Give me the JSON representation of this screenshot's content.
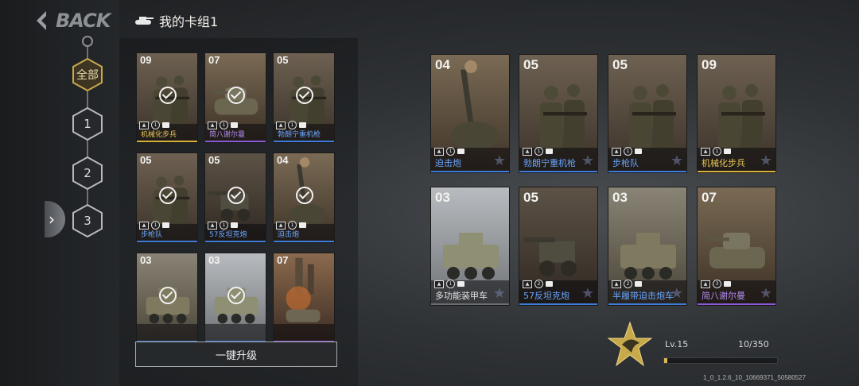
{
  "header": {
    "back_text": "BACK",
    "deck_title": "我的卡组1",
    "deck_icon": "tank-icon"
  },
  "filters": [
    {
      "label": "全部",
      "active": true
    },
    {
      "label": "1",
      "active": false
    },
    {
      "label": "2",
      "active": false
    },
    {
      "label": "3",
      "active": false
    }
  ],
  "collection": [
    {
      "cost": "09",
      "name": "机械化步兵",
      "art": "infantry",
      "rarity": "gold",
      "selected": true
    },
    {
      "cost": "07",
      "name": "简八谢尔曼",
      "art": "tank",
      "rarity": "purple",
      "selected": true
    },
    {
      "cost": "05",
      "name": "勃朗宁重机枪",
      "art": "infantry",
      "rarity": "blue",
      "selected": true
    },
    {
      "cost": "05",
      "name": "步枪队",
      "art": "infantry",
      "rarity": "blue",
      "selected": true
    },
    {
      "cost": "05",
      "name": "57反坦克炮",
      "art": "gun",
      "rarity": "blue",
      "selected": true
    },
    {
      "cost": "04",
      "name": "迫击炮",
      "art": "mortar",
      "rarity": "blue",
      "selected": true
    },
    {
      "cost": "03",
      "name": "",
      "art": "halftrack",
      "rarity": "blue",
      "selected": true
    },
    {
      "cost": "03",
      "name": "",
      "art": "armored",
      "rarity": "blue",
      "selected": true
    },
    {
      "cost": "07",
      "name": "",
      "art": "city",
      "rarity": "purple",
      "selected": false
    }
  ],
  "deck": [
    {
      "cost": "04",
      "name": "迫击炮",
      "art": "mortar",
      "rarity": "blue",
      "stat": "1"
    },
    {
      "cost": "05",
      "name": "勃朗宁重机枪",
      "art": "infantry",
      "rarity": "blue",
      "stat": "1"
    },
    {
      "cost": "05",
      "name": "步枪队",
      "art": "infantry",
      "rarity": "blue",
      "stat": "1"
    },
    {
      "cost": "09",
      "name": "机械化步兵",
      "art": "infantry",
      "rarity": "gold",
      "stat": "1"
    },
    {
      "cost": "03",
      "name": "多功能装甲车",
      "art": "armored",
      "rarity": "gray",
      "stat": "1"
    },
    {
      "cost": "05",
      "name": "57反坦克炮",
      "art": "gun",
      "rarity": "blue",
      "stat": "2"
    },
    {
      "cost": "03",
      "name": "半履带迫击炮车",
      "art": "halftrack",
      "rarity": "blue",
      "stat": "2"
    },
    {
      "cost": "07",
      "name": "简八谢尔曼",
      "art": "tank",
      "rarity": "purple",
      "stat": "3"
    }
  ],
  "bottom": {
    "upgrade_label": "一键升级",
    "level": "Lv.15",
    "xp": "10/350",
    "xp_fraction": 0.03,
    "version": "1_0_1.2.6_10_10669371_50580527"
  },
  "colors": {
    "gold": "#d7b13c",
    "blue": "#3f7bd8",
    "purple": "#8a5ad6",
    "gray": "#6b6e73",
    "name_blue": "#6aa6ff",
    "name_gold": "#e8c55a",
    "name_purple": "#b48cf0",
    "name_gray": "#e6e6e6"
  }
}
